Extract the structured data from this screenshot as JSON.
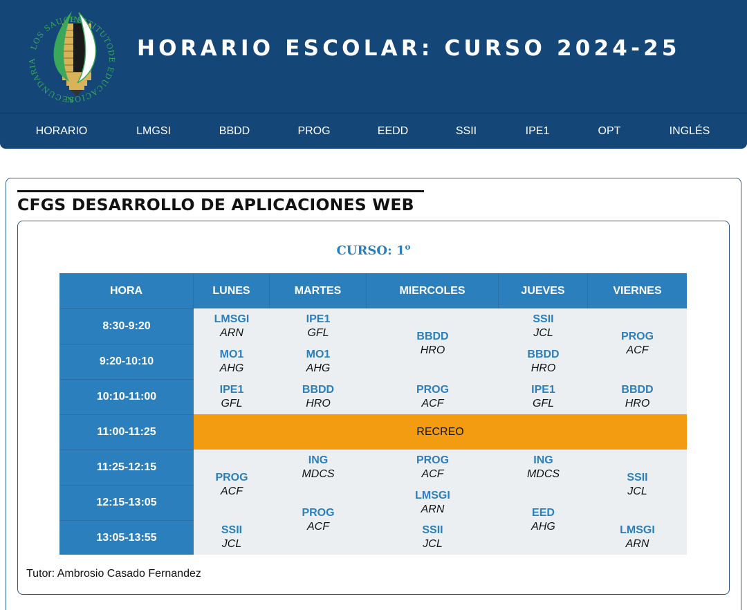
{
  "header": {
    "title": "HORARIO ESCOLAR: CURSO 2024-25",
    "logo_text_top": "LOS SAUCES",
    "logo_text_right": "INSTITUTO",
    "logo_text_bottom": "DE EDUCACION",
    "logo_text_left": "SECUNDARIA"
  },
  "nav": [
    "HORARIO",
    "LMGSI",
    "BBDD",
    "PROG",
    "EEDD",
    "SSII",
    "IPE1",
    "OPT",
    "INGLÉS"
  ],
  "section_title": "CFGS DESARROLLO DE APLICACIONES WEB",
  "course": {
    "label": "CURSO: 1",
    "sup": "o"
  },
  "table": {
    "headers": [
      "HORA",
      "LUNES",
      "MARTES",
      "MIERCOLES",
      "JUEVES",
      "VIERNES"
    ],
    "hours": [
      "8:30-9:20",
      "9:20-10:10",
      "10:10-11:00",
      "11:00-11:25",
      "11:25-12:15",
      "12:15-13:05",
      "13:05-13:55"
    ],
    "recreo": "RECREO",
    "cells": [
      {
        "subject": "LMSGI",
        "teacher": "ARN"
      },
      {
        "subject": "MO1",
        "teacher": "AHG"
      },
      {
        "subject": "IPE1",
        "teacher": "GFL"
      },
      {
        "subject": "PROG",
        "teacher": "ACF"
      },
      {
        "subject": "SSII",
        "teacher": "JCL"
      },
      {
        "subject": "IPE1",
        "teacher": "GFL"
      },
      {
        "subject": "MO1",
        "teacher": "AHG"
      },
      {
        "subject": "BBDD",
        "teacher": "HRO"
      },
      {
        "subject": "ING",
        "teacher": "MDCS"
      },
      {
        "subject": "PROG",
        "teacher": "ACF"
      },
      {
        "subject": "BBDD",
        "teacher": "HRO"
      },
      {
        "subject": "PROG",
        "teacher": "ACF"
      },
      {
        "subject": "PROG",
        "teacher": "ACF"
      },
      {
        "subject": "LMSGI",
        "teacher": "ARN"
      },
      {
        "subject": "SSII",
        "teacher": "JCL"
      },
      {
        "subject": "SSII",
        "teacher": "JCL"
      },
      {
        "subject": "BBDD",
        "teacher": "HRO"
      },
      {
        "subject": "IPE1",
        "teacher": "GFL"
      },
      {
        "subject": "ING",
        "teacher": "MDCS"
      },
      {
        "subject": "EED",
        "teacher": "AHG"
      },
      {
        "subject": "PROG",
        "teacher": "ACF"
      },
      {
        "subject": "BBDD",
        "teacher": "HRO"
      },
      {
        "subject": "SSII",
        "teacher": "JCL"
      },
      {
        "subject": "LMSGI",
        "teacher": "ARN"
      }
    ]
  },
  "tutor": "Tutor: Ambrosio Casado Fernandez",
  "colors": {
    "header_bg": "#144677",
    "accent_blue": "#2b7fbd",
    "cell_bg": "#ebeff1",
    "recreo": "#f39c12"
  }
}
